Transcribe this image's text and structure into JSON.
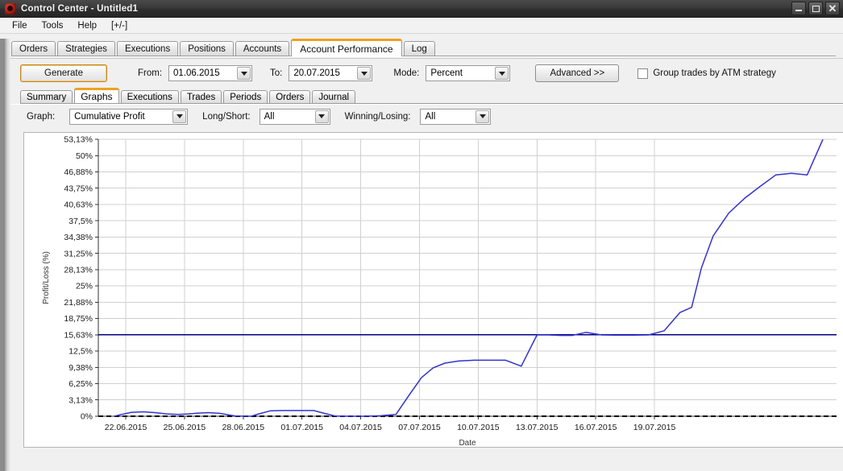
{
  "window": {
    "title": "Control Center - Untitled1",
    "icon": "app-icon",
    "buttons": {
      "minimize": "–",
      "maximize": "❐",
      "close": "✕"
    }
  },
  "menu": {
    "items": [
      "File",
      "Tools",
      "Help",
      "[+/-]"
    ]
  },
  "tabs": {
    "items": [
      "Orders",
      "Strategies",
      "Executions",
      "Positions",
      "Accounts",
      "Account Performance",
      "Log"
    ],
    "active": "Account Performance"
  },
  "toolbar": {
    "generate_label": "Generate",
    "from_label": "From:",
    "from_value": "01.06.2015",
    "to_label": "To:",
    "to_value": "20.07.2015",
    "mode_label": "Mode:",
    "mode_value": "Percent",
    "advanced_label": "Advanced >>",
    "group_checkbox_label": "Group trades by ATM strategy",
    "group_checked": false
  },
  "subtabs": {
    "items": [
      "Summary",
      "Graphs",
      "Executions",
      "Trades",
      "Periods",
      "Orders",
      "Journal"
    ],
    "active": "Graphs"
  },
  "filters": {
    "graph_label": "Graph:",
    "graph_value": "Cumulative Profit",
    "longshort_label": "Long/Short:",
    "longshort_value": "All",
    "winloss_label": "Winning/Losing:",
    "winloss_value": "All"
  },
  "colors": {
    "accent": "#f0a020",
    "series_line": "#3333cc",
    "reference_line": "#000080",
    "zero_line": "#000000",
    "grid": "#d0d0d0",
    "chart_bg": "#ffffff"
  },
  "chart_data": {
    "type": "line",
    "title": "",
    "xlabel": "Date",
    "ylabel": "Profit/Loss (%)",
    "grid": true,
    "legend": "none",
    "ylim": [
      0,
      53.13
    ],
    "yticks": [
      0,
      3.13,
      6.25,
      9.38,
      12.5,
      15.63,
      18.75,
      21.88,
      25,
      28.13,
      31.25,
      34.38,
      37.5,
      40.63,
      43.75,
      46.88,
      50,
      53.13
    ],
    "ytick_labels": [
      "0%",
      "3,13%",
      "6,25%",
      "9,38%",
      "12,5%",
      "15,63%",
      "18,75%",
      "21,88%",
      "25%",
      "28,13%",
      "31,25%",
      "34,38%",
      "37,5%",
      "40,63%",
      "43,75%",
      "46,88%",
      "50%",
      "53,13%"
    ],
    "xtick_labels": [
      "22.06.2015",
      "25.06.2015",
      "28.06.2015",
      "01.07.2015",
      "04.07.2015",
      "07.07.2015",
      "10.07.2015",
      "13.07.2015",
      "16.07.2015",
      "19.07.2015"
    ],
    "xlim_days": [
      21.0,
      20.4
    ],
    "reference_lines": [
      {
        "name": "current-level",
        "value": 15.63,
        "color": "#000080",
        "style": "solid"
      },
      {
        "name": "zero-line",
        "value": 0,
        "color": "#000000",
        "style": "dashed"
      }
    ],
    "series": [
      {
        "name": "Cumulative Profit",
        "color": "#3333cc",
        "x": [
          21.4,
          21.8,
          22.3,
          22.9,
          23.5,
          24.1,
          24.7,
          25.2,
          25.7,
          26.2,
          26.8,
          27.6,
          28.4,
          28.9,
          29.4,
          30.0,
          30.6,
          31.2,
          31.6,
          32.1,
          32.7,
          33.4,
          34.2,
          35.0,
          35.8,
          36.5,
          37.1,
          37.7,
          38.3,
          39.0,
          39.8,
          40.6,
          41.4,
          42.2,
          43.0,
          43.6,
          44.2,
          44.8,
          45.5,
          46.3,
          47.1,
          47.9,
          48.7,
          49.5,
          50.3,
          50.9
        ],
        "y": [
          0.0,
          0.35,
          0.75,
          0.85,
          0.7,
          0.45,
          0.35,
          0.45,
          0.6,
          0.7,
          0.55,
          0.05,
          0.0,
          0.55,
          1.05,
          1.1,
          1.1,
          1.1,
          1.1,
          0.6,
          0.05,
          0.0,
          0.0,
          0.1,
          0.35,
          4.2,
          7.4,
          9.3,
          10.2,
          10.6,
          10.75,
          10.75,
          10.75,
          9.6,
          15.6,
          15.6,
          15.5,
          15.5,
          16.1,
          15.6,
          15.55,
          15.55,
          15.6,
          16.4,
          19.9,
          20.9
        ]
      }
    ],
    "series_extension": {
      "x": [
        50.9,
        51.4,
        52.0,
        52.8,
        53.6,
        54.4,
        55.2,
        56.0,
        56.8,
        57.6
      ],
      "y": [
        20.9,
        28.5,
        34.6,
        39.0,
        41.8,
        44.1,
        46.3,
        46.6,
        46.3,
        53.1
      ]
    }
  }
}
